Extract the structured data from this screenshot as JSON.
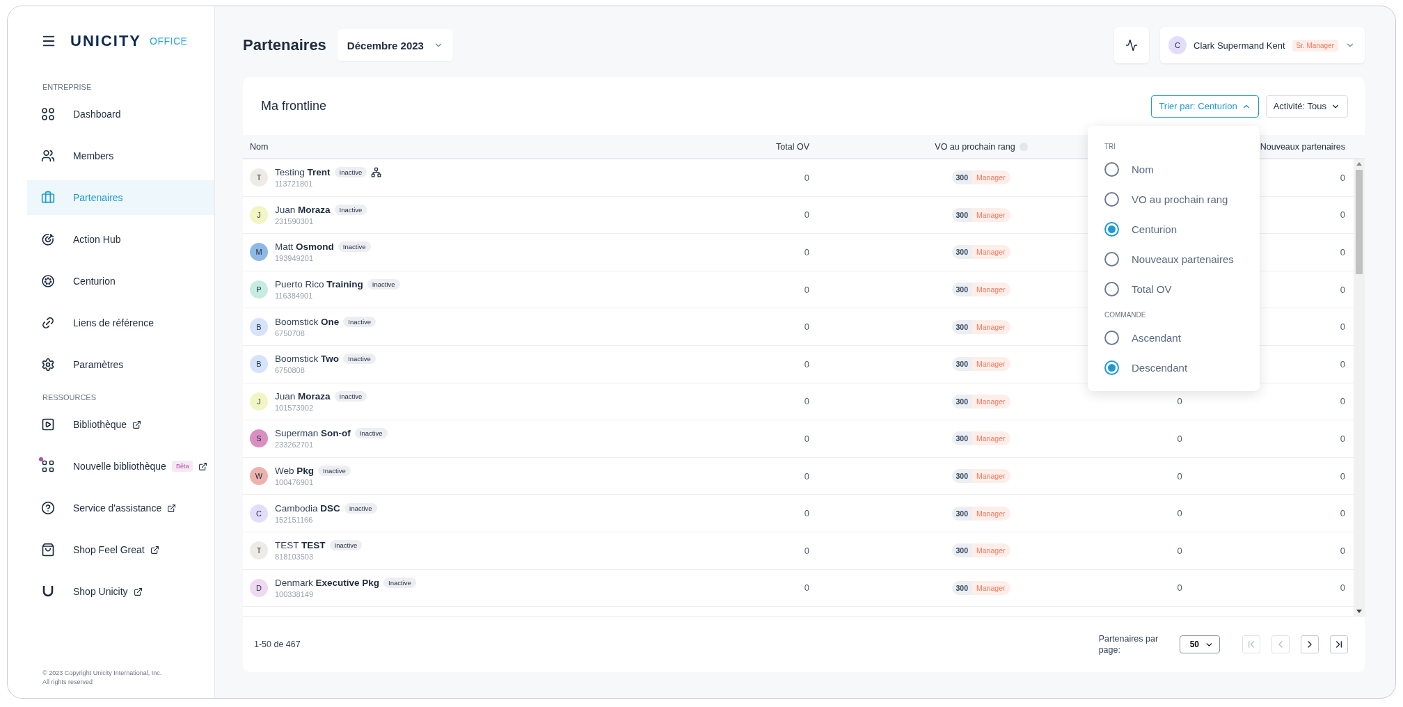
{
  "sidebar": {
    "logo": {
      "brand": "UNICITY",
      "product": "OFFICE"
    },
    "sections": [
      {
        "title": "ENTREPRISE",
        "items": [
          {
            "label": "Dashboard",
            "selected": false
          },
          {
            "label": "Members",
            "selected": false
          },
          {
            "label": "Partenaires",
            "selected": true
          },
          {
            "label": "Action Hub",
            "selected": false
          },
          {
            "label": "Centurion",
            "selected": false
          },
          {
            "label": "Liens de référence",
            "selected": false
          },
          {
            "label": "Paramètres",
            "selected": false
          }
        ]
      },
      {
        "title": "RESSOURCES",
        "items": [
          {
            "label": "Bibliothèque",
            "selected": false,
            "external": true
          },
          {
            "label": "Nouvelle bibliothèque",
            "selected": false,
            "external": true,
            "badge": "Bêta",
            "dot": true
          },
          {
            "label": "Service d'assistance",
            "selected": false,
            "external": true
          },
          {
            "label": "Shop Feel Great",
            "selected": false,
            "external": true
          },
          {
            "label": "Shop Unicity",
            "selected": false,
            "external": true
          }
        ]
      }
    ],
    "copyright": [
      "© 2023 Copyright Unicity International, Inc.",
      "All rights reserved"
    ]
  },
  "header": {
    "title": "Partenaires",
    "period": "Décembre 2023",
    "user": {
      "initial": "C",
      "name": "Clark Supermand Kent",
      "rank": "Sr. Manager"
    }
  },
  "card": {
    "title": "Ma frontline",
    "sort_button": "Trier par: Centurion",
    "activity_button": "Activité: Tous",
    "sort_menu": {
      "sections": [
        {
          "title": "TRI",
          "options": [
            {
              "label": "Nom",
              "selected": false
            },
            {
              "label": "VO au prochain rang",
              "selected": false
            },
            {
              "label": "Centurion",
              "selected": true
            },
            {
              "label": "Nouveaux partenaires",
              "selected": false
            },
            {
              "label": "Total OV",
              "selected": false
            }
          ]
        },
        {
          "title": "COMMANDE",
          "options": [
            {
              "label": "Ascendant",
              "selected": false
            },
            {
              "label": "Descendant",
              "selected": true
            }
          ]
        }
      ]
    },
    "columns": [
      "Nom",
      "Total OV",
      "VO au prochain rang",
      "Nouveaux partenaires"
    ],
    "rows": [
      {
        "initial": "T",
        "color": "#eeebe6",
        "first": "Testing",
        "last": "Trent",
        "status": "Inactive",
        "id": "113721801",
        "tree": true,
        "total_ov": "0",
        "vo": "300",
        "rank": "Manager",
        "new_partners": "0"
      },
      {
        "initial": "J",
        "color": "#f2f5c4",
        "first": "Juan",
        "last": "Moraza",
        "status": "Inactive",
        "id": "231590301",
        "total_ov": "0",
        "vo": "300",
        "rank": "Manager",
        "new_partners": "0"
      },
      {
        "initial": "M",
        "color": "#8fb8e6",
        "first": "Matt",
        "last": "Osmond",
        "status": "Inactive",
        "id": "193949201",
        "total_ov": "0",
        "vo": "300",
        "rank": "Manager",
        "new_partners": "0"
      },
      {
        "initial": "P",
        "color": "#c6ebe1",
        "first": "Puerto Rico",
        "last": "Training",
        "status": "Inactive",
        "id": "116384901",
        "total_ov": "0",
        "vo": "300",
        "rank": "Manager",
        "new_partners": "0"
      },
      {
        "initial": "B",
        "color": "#d5e3fb",
        "first": "Boomstick",
        "last": "One",
        "status": "Inactive",
        "id": "6750708",
        "total_ov": "0",
        "vo": "300",
        "rank": "Manager",
        "new_partners": "0"
      },
      {
        "initial": "B",
        "color": "#d5e3fb",
        "first": "Boomstick",
        "last": "Two",
        "status": "Inactive",
        "id": "6750808",
        "total_ov": "0",
        "vo": "300",
        "rank": "Manager",
        "new_partners": "0"
      },
      {
        "initial": "J",
        "color": "#f2f5c4",
        "first": "Juan",
        "last": "Moraza",
        "status": "Inactive",
        "id": "101573902",
        "total_ov": "0",
        "vo": "300",
        "rank": "Manager",
        "column_4": "0",
        "new_partners": "0"
      },
      {
        "initial": "S",
        "color": "#d98fc0",
        "first": "Superman",
        "last": "Son-of",
        "status": "Inactive",
        "id": "233262701",
        "total_ov": "0",
        "vo": "300",
        "rank": "Manager",
        "column_4": "0",
        "new_partners": "0"
      },
      {
        "initial": "W",
        "color": "#eeb2ac",
        "first": "Web",
        "last": "Pkg",
        "status": "Inactive",
        "id": "100476901",
        "total_ov": "0",
        "vo": "300",
        "rank": "Manager",
        "column_4": "0",
        "new_partners": "0"
      },
      {
        "initial": "C",
        "color": "#e3ddfb",
        "first": "Cambodia",
        "last": "DSC",
        "status": "Inactive",
        "id": "152151166",
        "total_ov": "0",
        "vo": "300",
        "rank": "Manager",
        "column_4": "0",
        "new_partners": "0"
      },
      {
        "initial": "T",
        "color": "#eeebe6",
        "first": "TEST",
        "last": "TEST",
        "status": "Inactive",
        "id": "818103503",
        "total_ov": "0",
        "vo": "300",
        "rank": "Manager",
        "column_4": "0",
        "new_partners": "0"
      },
      {
        "initial": "D",
        "color": "#efd8f1",
        "first": "Denmark",
        "last": "Executive Pkg",
        "status": "Inactive",
        "id": "100338149",
        "total_ov": "0",
        "vo": "300",
        "rank": "Manager",
        "column_4": "0",
        "new_partners": "0"
      }
    ],
    "footer": {
      "range": "1-50 de 467",
      "per_page_label": "Partenaires par page:",
      "per_page": "50",
      "pager": [
        {
          "kind": "first",
          "disabled": true
        },
        {
          "kind": "prev",
          "disabled": true
        },
        {
          "kind": "next",
          "disabled": false
        },
        {
          "kind": "last",
          "disabled": false
        }
      ]
    }
  }
}
